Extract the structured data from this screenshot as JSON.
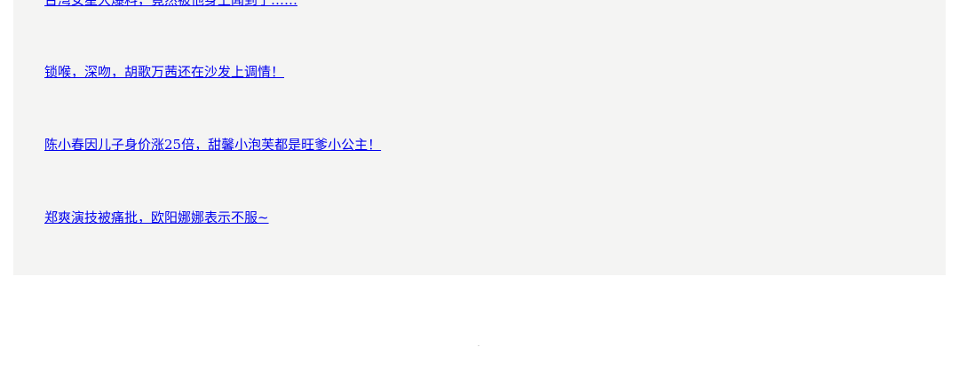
{
  "news_links": [
    {
      "text": "台湾女星大爆料，竟然被他身上闻到了……"
    },
    {
      "text": "锁喉，深吻，胡歌万茜还在沙发上调情！"
    },
    {
      "text": "陈小春因儿子身价涨25倍，甜馨小泡芙都是旺爹小公主！"
    },
    {
      "text": "郑爽演技被痛批，欧阳娜娜表示不服~"
    }
  ]
}
